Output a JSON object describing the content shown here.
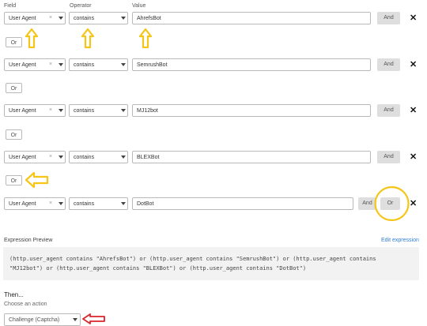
{
  "headers": {
    "field": "Field",
    "operator": "Operator",
    "value": "Value"
  },
  "rows": [
    {
      "field": "User Agent",
      "operator": "contains",
      "value": "AhrefsBot",
      "and_label": "And"
    },
    {
      "field": "User Agent",
      "operator": "contains",
      "value": "SemrushBot",
      "and_label": "And"
    },
    {
      "field": "User Agent",
      "operator": "contains",
      "value": "MJ12bot",
      "and_label": "And"
    },
    {
      "field": "User Agent",
      "operator": "contains",
      "value": "BLEXBot",
      "and_label": "And"
    },
    {
      "field": "User Agent",
      "operator": "contains",
      "value": "DotBot",
      "and_label": "And",
      "or_label": "Or"
    }
  ],
  "or_label": "Or",
  "clear_glyph": "×",
  "remove_glyph": "✕",
  "expression": {
    "title": "Expression Preview",
    "edit_link": "Edit expression",
    "line1": "(http.user_agent contains \"AhrefsBot\") or (http.user_agent contains \"SemrushBot\") or (http.user_agent contains",
    "line2": "\"MJ12bot\") or (http.user_agent contains \"BLEXBot\") or (http.user_agent contains \"DotBot\")"
  },
  "then": {
    "title": "Then...",
    "subtitle": "Choose an action",
    "action_value": "Challenge (Captcha)"
  },
  "colors": {
    "accent": "#2f7fd1",
    "annotation_yellow": "#f5c518",
    "annotation_red": "#d9262b"
  },
  "icons": [
    "clear-x-icon",
    "chevron-down-icon",
    "close-icon",
    "up-arrow-annotation",
    "left-arrow-annotation"
  ]
}
